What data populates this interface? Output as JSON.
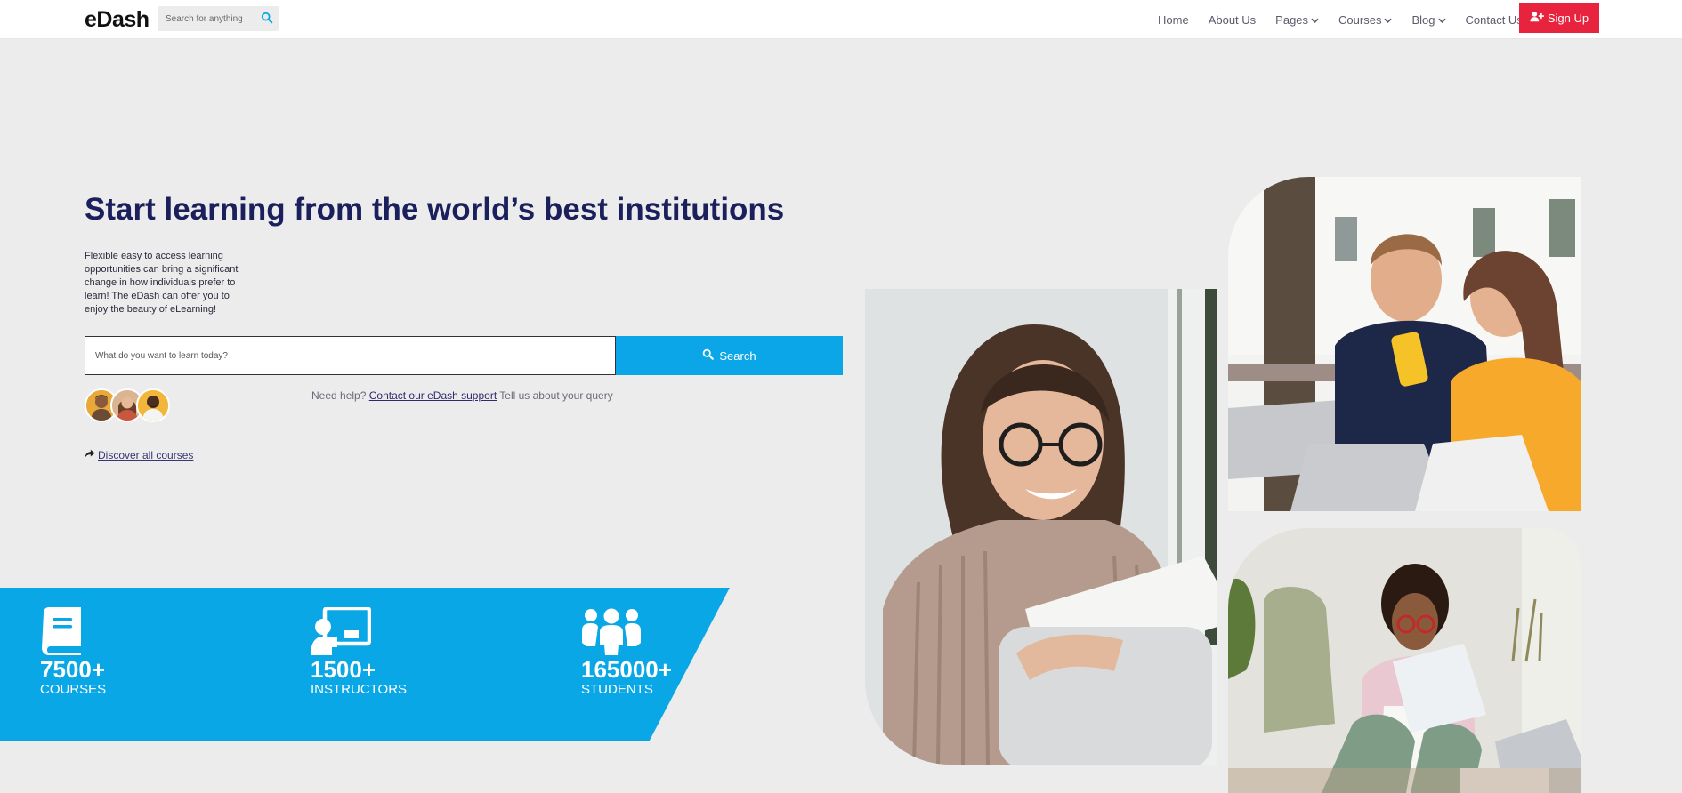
{
  "nav": {
    "logo": "eDash",
    "search_placeholder": "Search for anything",
    "links": {
      "home": "Home",
      "about": "About Us",
      "pages": "Pages",
      "courses": "Courses",
      "blog": "Blog",
      "contact": "Contact Us"
    },
    "signup_label": "Sign Up"
  },
  "hero": {
    "title": "Start learning from the world’s best institutions",
    "description": "Flexible easy to access learning opportunities can bring a significant change in how individuals prefer to learn! The eDash can offer you to enjoy the beauty of eLearning!",
    "search_placeholder": "What do you want to learn today?",
    "search_button": "Search",
    "help_prefix": "Need help?",
    "help_link": "Contact our eDash support",
    "help_suffix": "Tell us about your query",
    "discover_link": "Discover all courses"
  },
  "stats": [
    {
      "value": "7500+",
      "label": "COURSES",
      "icon": "book-icon"
    },
    {
      "value": "1500+",
      "label": "INSTRUCTORS",
      "icon": "instructor-icon"
    },
    {
      "value": "165000+",
      "label": "STUDENTS",
      "icon": "students-icon"
    }
  ],
  "colors": {
    "accent_blue": "#0ba6e7",
    "signup_red": "#e8233d",
    "title_navy": "#1b1f5c",
    "background": "#ececec"
  }
}
